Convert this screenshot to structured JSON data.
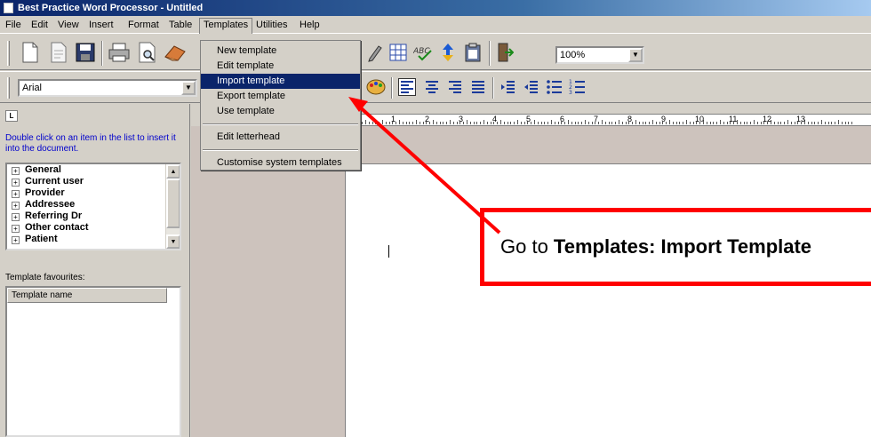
{
  "window": {
    "title": "Best Practice Word Processor - Untitled"
  },
  "menubar": {
    "items": [
      "File",
      "Edit",
      "View",
      "Insert",
      "Format",
      "Table",
      "Templates",
      "Utilities",
      "Help"
    ]
  },
  "templates_menu": {
    "items": [
      "New template",
      "Edit template",
      "Import template",
      "Export template",
      "Use template",
      "Edit letterhead",
      "Customise system templates"
    ],
    "selected": "Import template"
  },
  "toolbar": {
    "zoom": "100%",
    "font": "Arial"
  },
  "left_panel": {
    "ruler_corner": "L",
    "hint": "Double click on an item in the list to insert it into the document.",
    "tree_items": [
      "General",
      "Current user",
      "Provider",
      "Addressee",
      "Referring Dr",
      "Other contact",
      "Patient"
    ],
    "favourites_label": "Template favourites:",
    "favourites_column": "Template name"
  },
  "ruler": {
    "numbers": [
      "1",
      "2",
      "3",
      "4",
      "5",
      "6",
      "7",
      "8",
      "9",
      "10",
      "11",
      "12",
      "13"
    ]
  },
  "callout": {
    "prefix": "Go to ",
    "bold": "Templates: Import Template"
  },
  "colors": {
    "annotation": "#ff0000",
    "selection": "#0a246a",
    "titlebar": "#0a246a"
  }
}
